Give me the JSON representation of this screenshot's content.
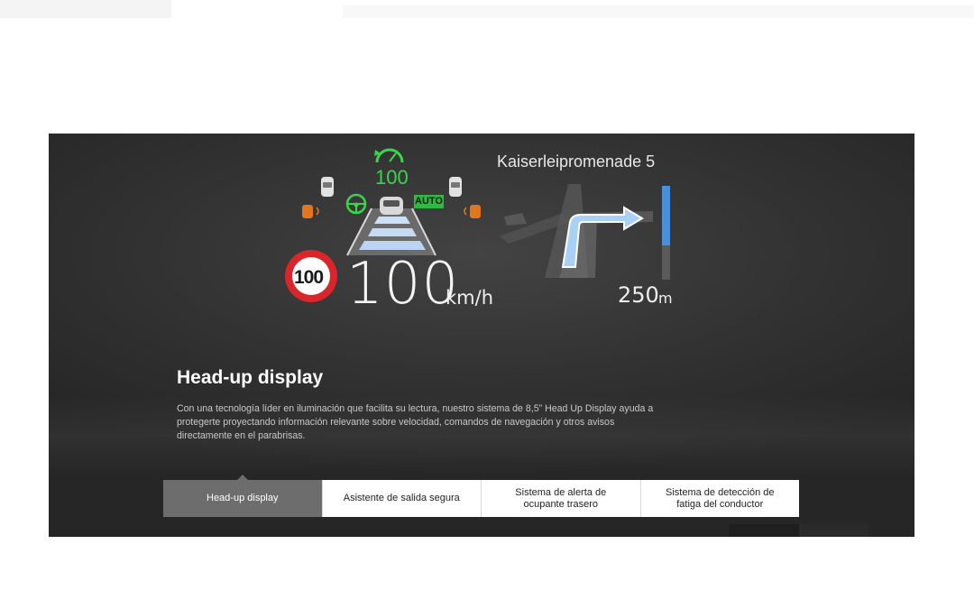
{
  "hud": {
    "street_name": "Kaiserleipromenade 5",
    "cruise_set_speed": "100",
    "auto_badge": "AUTO",
    "speed_limit": "100",
    "current_speed": "100",
    "speed_unit": "km/h",
    "turn_distance": "250",
    "turn_distance_unit": "m",
    "distance_progress_fraction": 0.3
  },
  "section": {
    "title": "Head-up display",
    "description": "Con una tecnología líder en iluminación que facilita su lectura, nuestro sistema de 8,5” Head Up Display ayuda a protegerte proyectando información relevante sobre velocidad, comandos de navegación y otros avisos directamente en el parabrisas."
  },
  "tabs": [
    {
      "label": "Head-up display",
      "active": true
    },
    {
      "label": "Asistente de salida segura",
      "active": false
    },
    {
      "label": "Sistema de alerta de ocupante trasero",
      "active": false
    },
    {
      "label": "Sistema de detección de fatiga del conductor",
      "active": false
    }
  ],
  "colors": {
    "hud_green": "#39d64a",
    "warning_orange": "#e0761e",
    "nav_blue": "#4a8fdc",
    "active_tab": "#6d6d6d",
    "sign_red": "#d9262b"
  },
  "icons": {
    "cruise_gauge": "gauge-icon",
    "steering_wheel": "steering-wheel-icon",
    "turn_arrow": "turn-right-arrow-icon",
    "speed_sign": "speed-limit-sign-icon"
  }
}
